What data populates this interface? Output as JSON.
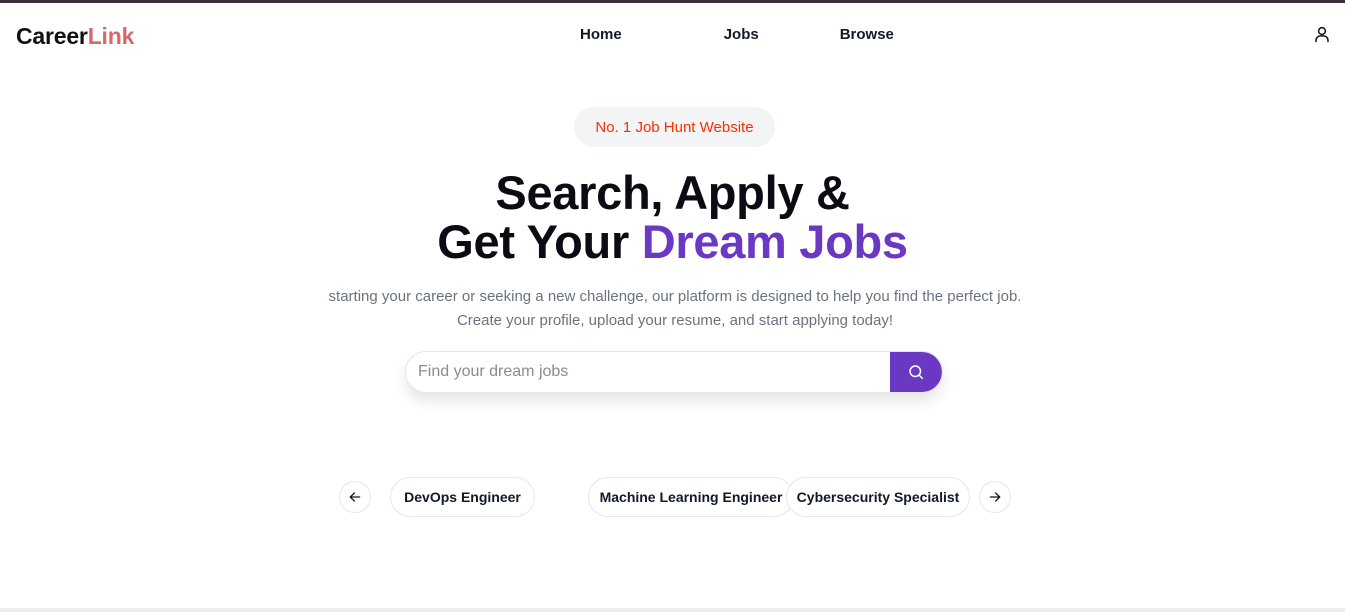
{
  "brand": {
    "part1": "Career",
    "part2": "Link"
  },
  "nav": {
    "items": [
      {
        "label": "Home"
      },
      {
        "label": "Jobs"
      },
      {
        "label": "Browse"
      }
    ],
    "user_icon": "user-icon"
  },
  "hero": {
    "badge": "No. 1 Job Hunt Website",
    "headline_line1": "Search, Apply &",
    "headline_line2_prefix": "Get Your ",
    "headline_line2_accent": "Dream Jobs",
    "subtitle_line1": "starting your career or seeking a new challenge, our platform is designed to help you find the perfect job.",
    "subtitle_line2": "Create your profile, upload your resume, and start applying today!"
  },
  "search": {
    "placeholder": "Find your dream jobs",
    "value": "",
    "button_icon": "search-icon"
  },
  "categories": {
    "prev_icon": "arrow-left-icon",
    "next_icon": "arrow-right-icon",
    "items": [
      {
        "label": "DevOps Engineer"
      },
      {
        "label": "Machine Learning Engineer"
      },
      {
        "label": "Cybersecurity Specialist"
      }
    ]
  },
  "colors": {
    "accent": "#6a38c2",
    "badge_text": "#f83002",
    "logo_accent": "#d46a6a"
  }
}
